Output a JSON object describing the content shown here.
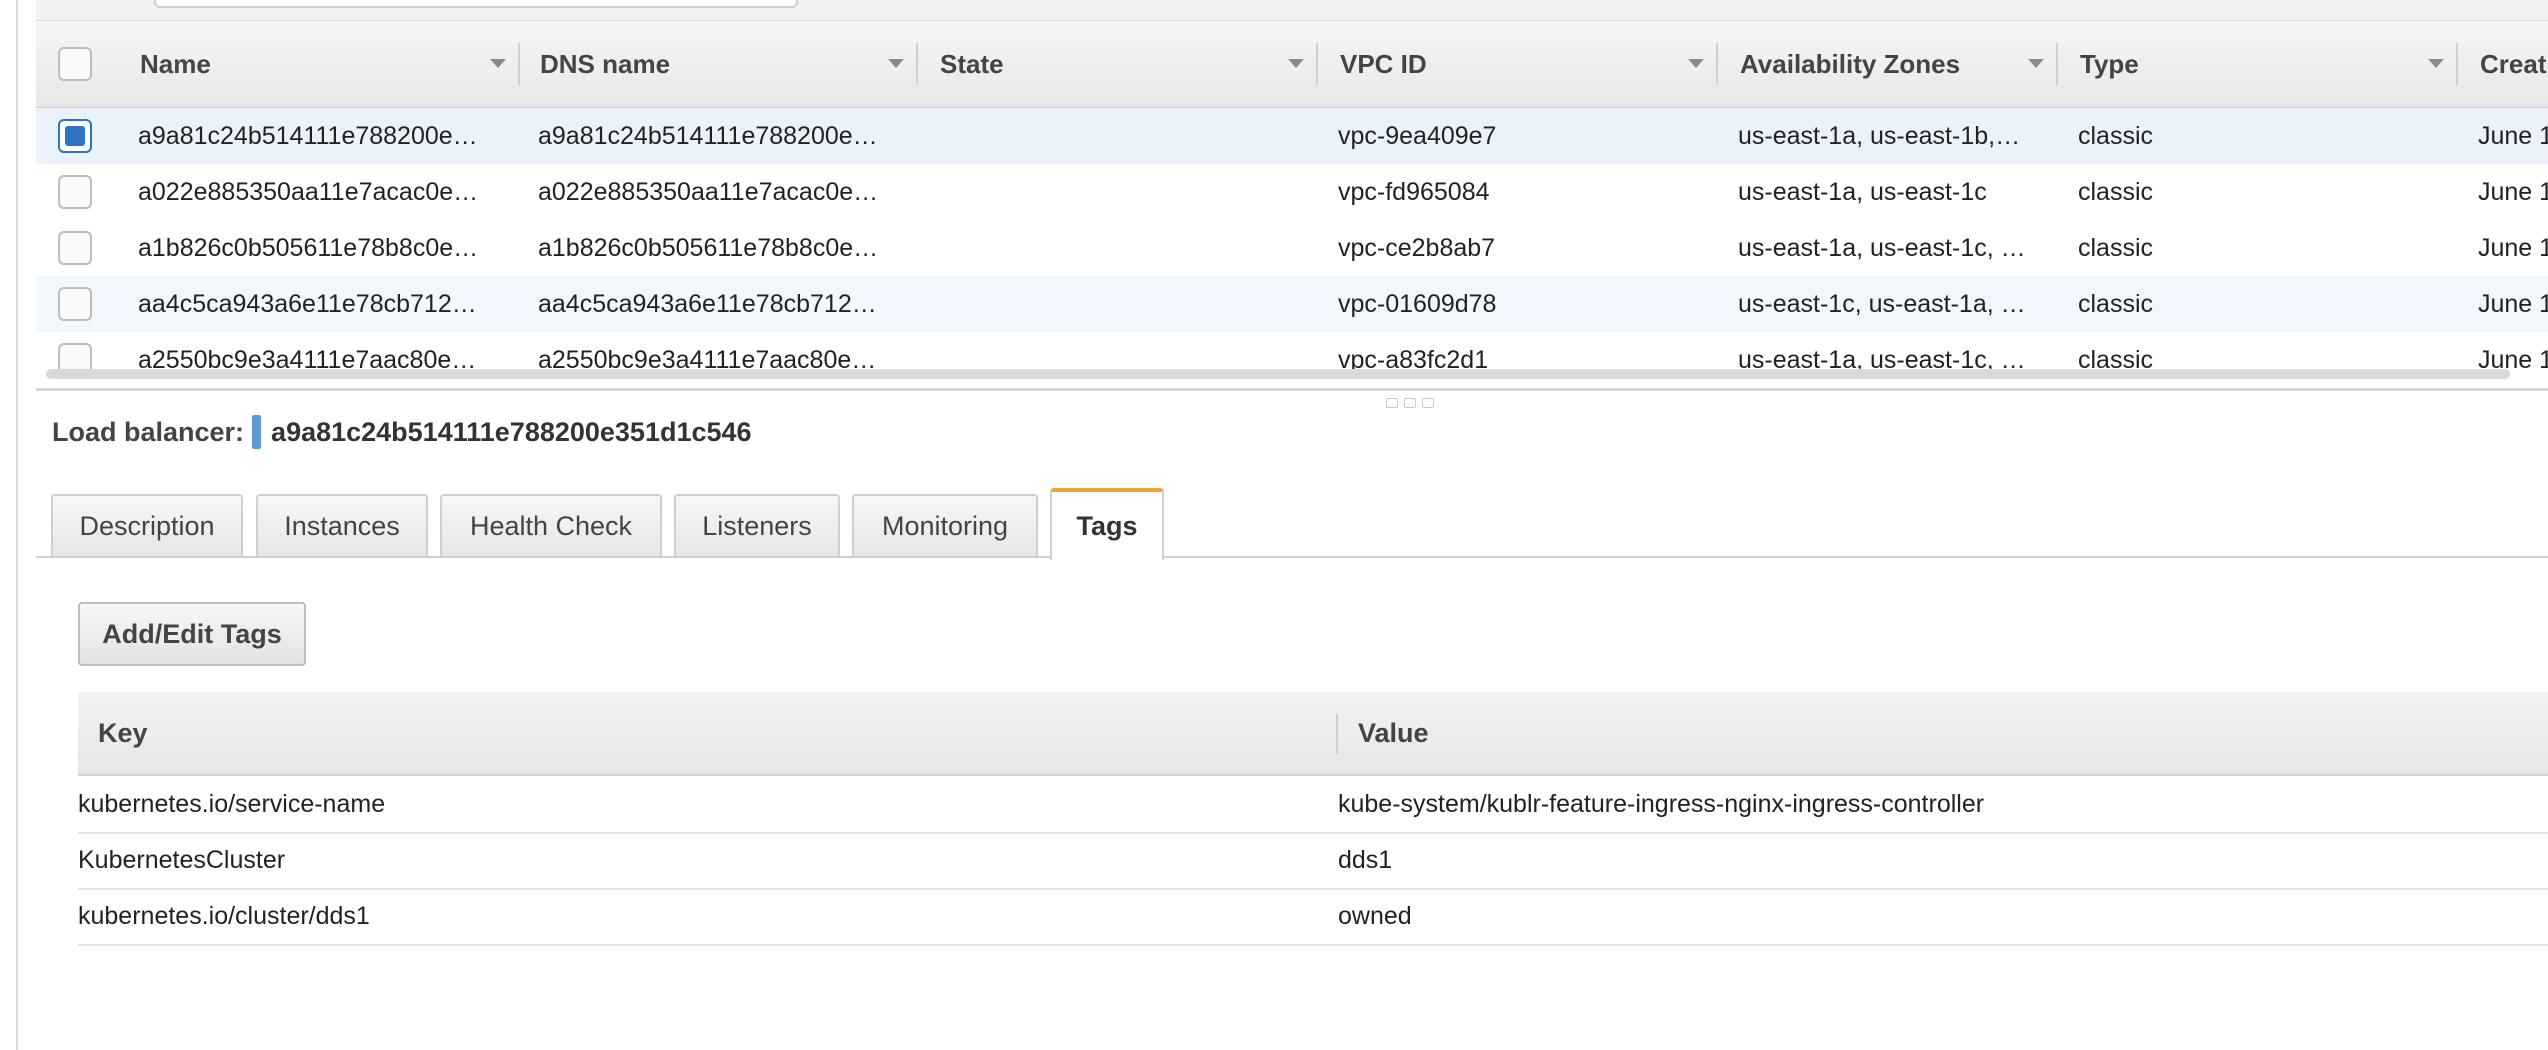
{
  "grid": {
    "columns": [
      "Name",
      "DNS name",
      "State",
      "VPC ID",
      "Availability Zones",
      "Type",
      "Creat"
    ],
    "rows": [
      {
        "checked": true,
        "name": "a9a81c24b514111e788200e…",
        "dns": "a9a81c24b514111e788200e…",
        "state": "",
        "vpc": "vpc-9ea409e7",
        "zones": "us-east-1a, us-east-1b,…",
        "type": "classic",
        "created": "June 1"
      },
      {
        "checked": false,
        "name": "a022e885350aa11e7acac0e…",
        "dns": "a022e885350aa11e7acac0e…",
        "state": "",
        "vpc": "vpc-fd965084",
        "zones": "us-east-1a, us-east-1c",
        "type": "classic",
        "created": "June 1"
      },
      {
        "checked": false,
        "name": "a1b826c0b505611e78b8c0e…",
        "dns": "a1b826c0b505611e78b8c0e…",
        "state": "",
        "vpc": "vpc-ce2b8ab7",
        "zones": "us-east-1a, us-east-1c, …",
        "type": "classic",
        "created": "June 1"
      },
      {
        "checked": false,
        "name": "aa4c5ca943a6e11e78cb712…",
        "dns": "aa4c5ca943a6e11e78cb712…",
        "state": "",
        "vpc": "vpc-01609d78",
        "zones": "us-east-1c, us-east-1a, …",
        "type": "classic",
        "created": "June 1"
      },
      {
        "checked": false,
        "name": "a2550bc9e3a4111e7aac80e…",
        "dns": "a2550bc9e3a4111e7aac80e…",
        "state": "",
        "vpc": "vpc-a83fc2d1",
        "zones": "us-east-1a, us-east-1c, …",
        "type": "classic",
        "created": "June 1"
      }
    ]
  },
  "detail": {
    "label": "Load balancer:",
    "value": "a9a81c24b514111e788200e351d1c546"
  },
  "tabs": [
    {
      "label": "Description",
      "active": false
    },
    {
      "label": "Instances",
      "active": false
    },
    {
      "label": "Health Check",
      "active": false
    },
    {
      "label": "Listeners",
      "active": false
    },
    {
      "label": "Monitoring",
      "active": false
    },
    {
      "label": "Tags",
      "active": true
    }
  ],
  "tags": {
    "button_label": "Add/Edit Tags",
    "headers": {
      "key": "Key",
      "value": "Value"
    },
    "rows": [
      {
        "key": "kubernetes.io/service-name",
        "value": "kube-system/kublr-feature-ingress-nginx-ingress-controller"
      },
      {
        "key": "KubernetesCluster",
        "value": "dds1"
      },
      {
        "key": "kubernetes.io/cluster/dds1",
        "value": "owned"
      }
    ]
  },
  "colors": {
    "accent": "#f0a12f",
    "selected_row": "#eaf2fc",
    "checkbox_checked": "#2f73c5"
  }
}
